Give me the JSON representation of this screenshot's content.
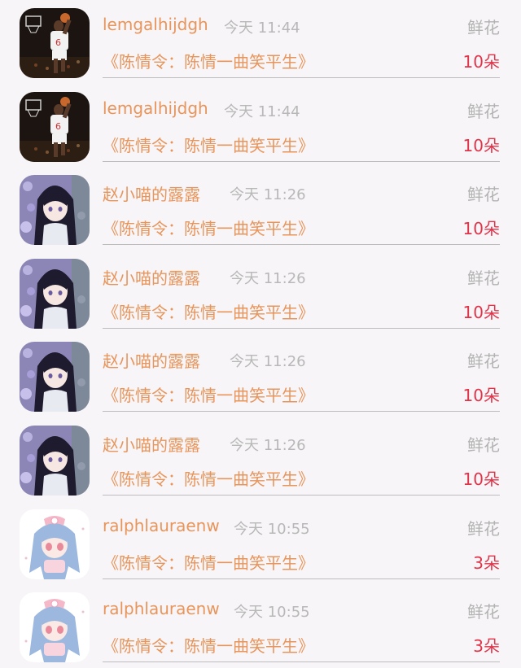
{
  "records": [
    {
      "name": "lemgalhijdgh",
      "time": "今天 11:44",
      "gift": "鲜花",
      "title": "《陈情令：陈情一曲笑平生》",
      "count": "10朵",
      "avatar": "basketball-player-avatar"
    },
    {
      "name": "lemgalhijdgh",
      "time": "今天 11:44",
      "gift": "鲜花",
      "title": "《陈情令：陈情一曲笑平生》",
      "count": "10朵",
      "avatar": "basketball-player-avatar"
    },
    {
      "name": "赵小喵的露露",
      "time": "今天 11:26",
      "gift": "鲜花",
      "title": "《陈情令：陈情一曲笑平生》",
      "count": "10朵",
      "avatar": "anime-girl-dark-hair-avatar"
    },
    {
      "name": "赵小喵的露露",
      "time": "今天 11:26",
      "gift": "鲜花",
      "title": "《陈情令：陈情一曲笑平生》",
      "count": "10朵",
      "avatar": "anime-girl-dark-hair-avatar"
    },
    {
      "name": "赵小喵的露露",
      "time": "今天 11:26",
      "gift": "鲜花",
      "title": "《陈情令：陈情一曲笑平生》",
      "count": "10朵",
      "avatar": "anime-girl-dark-hair-avatar"
    },
    {
      "name": "赵小喵的露露",
      "time": "今天 11:26",
      "gift": "鲜花",
      "title": "《陈情令：陈情一曲笑平生》",
      "count": "10朵",
      "avatar": "anime-girl-dark-hair-avatar"
    },
    {
      "name": "ralphlauraenw",
      "time": "今天 10:55",
      "gift": "鲜花",
      "title": "《陈情令：陈情一曲笑平生》",
      "count": "3朵",
      "avatar": "anime-girl-blue-hair-avatar"
    },
    {
      "name": "ralphlauraenw",
      "time": "今天 10:55",
      "gift": "鲜花",
      "title": "《陈情令：陈情一曲笑平生》",
      "count": "3朵",
      "avatar": "anime-girl-blue-hair-avatar"
    }
  ],
  "colors": {
    "accent": "#e8955c",
    "count": "#e0344a",
    "muted": "#b3b3b3",
    "divider": "#bdbdbd",
    "background": "#f7f5f7"
  }
}
